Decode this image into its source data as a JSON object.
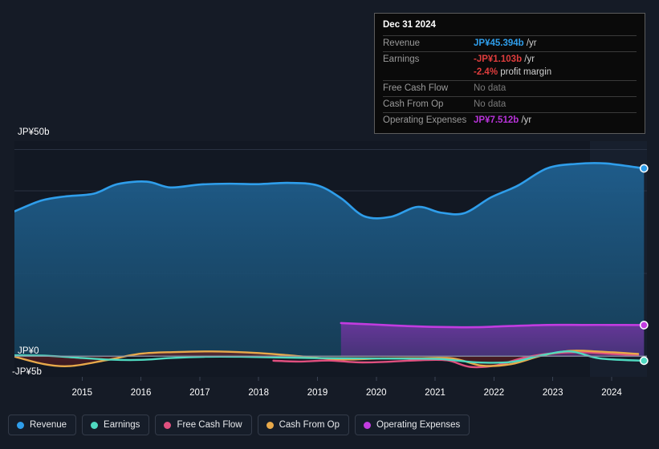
{
  "axes": {
    "y_labels": [
      {
        "text": "JP¥50b",
        "value": 50
      },
      {
        "text": "JP¥0",
        "value": 0
      },
      {
        "text": "-JP¥5b",
        "value": -5
      }
    ],
    "x_labels": [
      "2015",
      "2016",
      "2017",
      "2018",
      "2019",
      "2020",
      "2021",
      "2022",
      "2023",
      "2024"
    ]
  },
  "tooltip": {
    "title": "Dec 31 2024",
    "rows": [
      {
        "key": "Revenue",
        "value": "JP¥45.394b",
        "suffix": " /yr",
        "kind": "revenue"
      },
      {
        "key": "Earnings",
        "value": "-JP¥1.103b",
        "suffix": " /yr",
        "kind": "earnings"
      },
      {
        "key": "",
        "value": "-2.4%",
        "suffix": " profit margin",
        "kind": "margin"
      },
      {
        "key": "Free Cash Flow",
        "value": "No data",
        "suffix": "",
        "kind": "nodata"
      },
      {
        "key": "Cash From Op",
        "value": "No data",
        "suffix": "",
        "kind": "nodata"
      },
      {
        "key": "Operating Expenses",
        "value": "JP¥7.512b",
        "suffix": " /yr",
        "kind": "opex"
      }
    ]
  },
  "legend": [
    {
      "label": "Revenue",
      "color": "#2f9eeb"
    },
    {
      "label": "Earnings",
      "color": "#4fd9c0"
    },
    {
      "label": "Free Cash Flow",
      "color": "#e0507f"
    },
    {
      "label": "Cash From Op",
      "color": "#e8a94a"
    },
    {
      "label": "Operating Expenses",
      "color": "#c23ce0"
    }
  ],
  "colors": {
    "background": "#151b26",
    "revenue": "#2f9eeb",
    "earnings": "#4fd9c0",
    "free_cash_flow": "#e0507f",
    "cash_from_op": "#e8a94a",
    "operating_expenses": "#c23ce0",
    "gridline": "#2a3242",
    "zero_line": "#8a94a6"
  },
  "chart_data": {
    "type": "area",
    "title": "",
    "xlabel": "",
    "ylabel": "",
    "ylim": [
      -5,
      52
    ],
    "xlim": [
      2014.35,
      2025.1
    ],
    "grid": true,
    "legend_position": "bottom-left",
    "y_ticks": [
      50,
      0,
      -5
    ],
    "x_ticks": [
      2015,
      2016,
      2017,
      2018,
      2019,
      2020,
      2021,
      2022,
      2023,
      2024
    ],
    "units": "JP¥ billions per year",
    "annotations": [
      "Dec 31 2024: Revenue JP¥45.394b /yr",
      "Dec 31 2024: Earnings -JP¥1.103b /yr (-2.4% profit margin)",
      "Dec 31 2024: Free Cash Flow No data",
      "Dec 31 2024: Cash From Op No data",
      "Dec 31 2024: Operating Expenses JP¥7.512b /yr"
    ],
    "series": [
      {
        "name": "Revenue",
        "color": "#2f9eeb",
        "filled": true,
        "x": [
          2014.35,
          2014.8,
          2015.2,
          2015.7,
          2016.1,
          2016.6,
          2017.0,
          2017.5,
          2018.0,
          2018.5,
          2019.0,
          2019.5,
          2019.9,
          2020.3,
          2020.75,
          2021.2,
          2021.6,
          2022.0,
          2022.45,
          2022.9,
          2023.4,
          2023.9,
          2024.4,
          2025.05
        ],
        "y": [
          35.0,
          37.6,
          38.6,
          39.3,
          41.6,
          42.2,
          40.8,
          41.5,
          41.7,
          41.6,
          41.9,
          41.3,
          38.2,
          33.8,
          33.7,
          36.1,
          34.7,
          34.6,
          38.4,
          41.2,
          45.4,
          46.5,
          46.6,
          45.4
        ]
      },
      {
        "name": "Earnings",
        "color": "#4fd9c0",
        "filled": false,
        "x": [
          2014.35,
          2014.9,
          2015.4,
          2016.0,
          2016.5,
          2017.0,
          2017.6,
          2018.2,
          2018.8,
          2019.4,
          2019.9,
          2020.5,
          2021.0,
          2021.6,
          2022.2,
          2022.8,
          2023.3,
          2023.8,
          2024.3,
          2025.05
        ],
        "y": [
          0.2,
          0.1,
          -0.35,
          -0.85,
          -0.9,
          -0.45,
          -0.15,
          -0.15,
          -0.3,
          -0.45,
          -0.5,
          -0.55,
          -0.6,
          -0.7,
          -1.5,
          -1.4,
          0.2,
          1.15,
          -0.55,
          -1.1
        ]
      },
      {
        "name": "Free Cash Flow",
        "color": "#e0507f",
        "filled": false,
        "x": [
          2018.75,
          2019.2,
          2019.7,
          2020.2,
          2020.7,
          2021.2,
          2021.7,
          2022.1,
          2022.55,
          2023.0,
          2023.5,
          2024.0,
          2024.5,
          2024.95
        ],
        "y": [
          -1.1,
          -1.3,
          -1.05,
          -1.5,
          -1.35,
          -1.0,
          -1.0,
          -2.6,
          -2.2,
          -0.4,
          0.7,
          0.95,
          0.55,
          0.2
        ]
      },
      {
        "name": "Cash From Op",
        "color": "#e8a94a",
        "filled": false,
        "x": [
          2014.35,
          2014.85,
          2015.3,
          2015.9,
          2016.5,
          2017.1,
          2017.7,
          2018.3,
          2018.9,
          2019.5,
          2020.0,
          2020.6,
          2021.2,
          2021.8,
          2022.3,
          2022.8,
          2023.3,
          2023.8,
          2024.3,
          2024.95
        ],
        "y": [
          -0.1,
          -1.9,
          -2.4,
          -1.0,
          0.6,
          1.0,
          1.15,
          0.9,
          0.35,
          -0.4,
          -0.8,
          -0.55,
          -0.5,
          -0.55,
          -2.3,
          -1.9,
          0.1,
          1.3,
          1.1,
          0.55
        ]
      },
      {
        "name": "Operating Expenses",
        "color": "#c23ce0",
        "filled": true,
        "x": [
          2019.9,
          2020.4,
          2021.0,
          2021.6,
          2022.2,
          2022.8,
          2023.4,
          2024.0,
          2024.5,
          2025.05
        ],
        "y": [
          8.0,
          7.7,
          7.3,
          7.05,
          7.0,
          7.3,
          7.55,
          7.55,
          7.55,
          7.51
        ]
      }
    ]
  }
}
